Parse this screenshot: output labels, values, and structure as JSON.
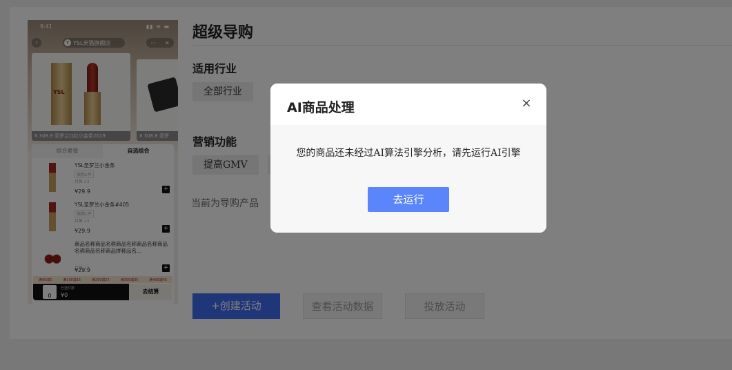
{
  "phone": {
    "time": "9:41",
    "status_icons": "▮▮ ≋ ▬",
    "back_glyph": "‹",
    "shop_logo": "Y",
    "shop_name": "YSL天猫旗舰店",
    "actions": [
      "···",
      "✕"
    ],
    "products": [
      {
        "price": "¥ 308.8",
        "name": "圣罗兰口红小金条2019"
      },
      {
        "price": "¥ 308.8",
        "name": "圣罗"
      }
    ],
    "tabs": [
      "组合套餐",
      "自选组合"
    ],
    "items": [
      {
        "name": "YSL圣罗兰小金条",
        "tag": "限购1件",
        "sub": "月售 23",
        "price": "¥29.9"
      },
      {
        "name": "YSL圣罗兰小金条#405",
        "tag": "限购1件",
        "sub": "月售 23",
        "price": "¥29.9"
      },
      {
        "name": "商品名称商品名称商品名称商品名称商品名称商品名称商品拼称品名...",
        "tag": "",
        "sub": "月售 23",
        "price": "¥29.9"
      }
    ],
    "coupons": [
      "满99减5",
      "满199减15",
      "满299减25",
      "满399减35",
      "满499减45"
    ],
    "cart": {
      "count": "0",
      "label": "已选件数",
      "total": "¥0",
      "checkout": "去结算"
    }
  },
  "page": {
    "title": "超级导购",
    "industry_label": "适用行业",
    "industry_chip": "全部行业",
    "marketing_label": "营销功能",
    "marketing_chip": "提高GMV",
    "hint": "当前为导购产品",
    "create_button": "+创建活动",
    "data_button": "查看活动数据",
    "launch_button": "投放活动"
  },
  "modal": {
    "title": "AI商品处理",
    "close": "×",
    "message": "您的商品还未经过AI算法引擎分析，请先运行AI引擎",
    "run_button": "去运行"
  }
}
